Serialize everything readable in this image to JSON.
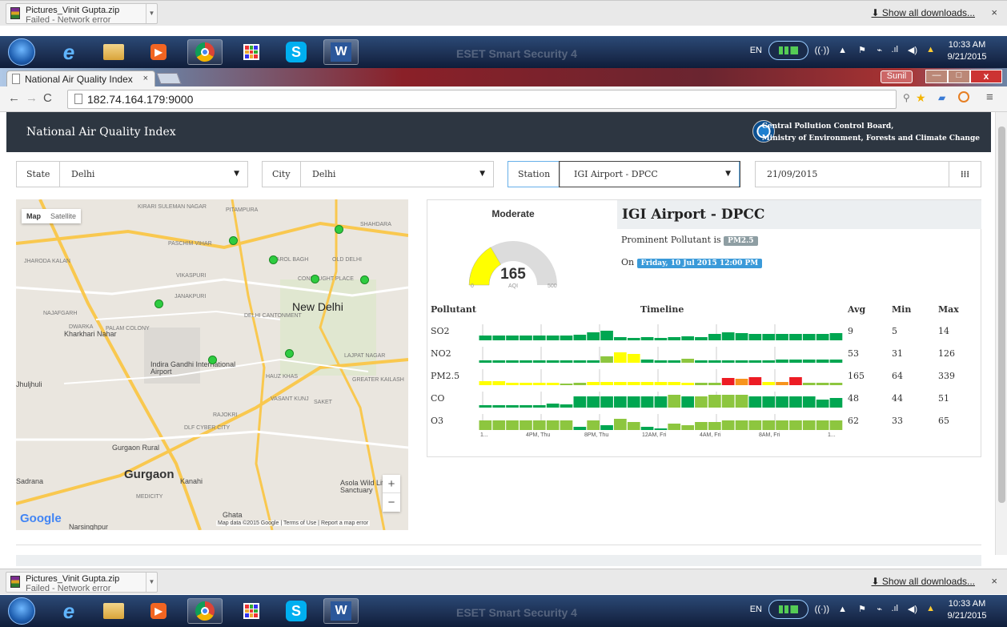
{
  "download_bar": {
    "file_name": "Pictures_Vinit Gupta.zip",
    "status": "Failed - Network error",
    "show_all": "Show all downloads...",
    "close": "×"
  },
  "taskbar": {
    "lang": "EN",
    "time": "10:33 AM",
    "date": "9/21/2015",
    "apps": [
      "ie-icon",
      "explorer-icon",
      "media-icon",
      "chrome-icon",
      "apps-icon",
      "skype-icon",
      "word-icon"
    ],
    "background_label": "ESET Smart Security 4"
  },
  "browser": {
    "tab_title": "National Air Quality Index",
    "tab_close": "×",
    "url": "182.74.164.179:9000",
    "user": "Sunil"
  },
  "site": {
    "title": "National Air Quality Index",
    "org_line1": "Central Pollution Control Board,",
    "org_line2": "Ministry of Environment, Forests and Climate Change"
  },
  "filters": {
    "state_label": "State",
    "state_value": "Delhi",
    "city_label": "City",
    "city_value": "Delhi",
    "station_label": "Station",
    "station_value": "IGI Airport - DPCC",
    "date_value": "21/09/2015"
  },
  "map": {
    "tab_map": "Map",
    "tab_satellite": "Satellite",
    "zoom_in": "+",
    "zoom_out": "−",
    "attribution": "Map data ©2015 Google",
    "terms": "Terms of Use",
    "report": "Report a map error",
    "google": "Google",
    "places": [
      {
        "name": "KIRARI SULEMAN NAGAR",
        "cls": "sm"
      },
      {
        "name": "PITAMPURA",
        "cls": "sm"
      },
      {
        "name": "SHAHDARA",
        "cls": "sm"
      },
      {
        "name": "PASCHIM VIHAR",
        "cls": "sm"
      },
      {
        "name": "KAROL BAGH",
        "cls": "sm"
      },
      {
        "name": "OLD DELHI",
        "cls": "sm"
      },
      {
        "name": "JHARODA KALAN",
        "cls": "sm"
      },
      {
        "name": "VIKASPURI",
        "cls": "sm"
      },
      {
        "name": "CONNAUGHT PLACE",
        "cls": "sm"
      },
      {
        "name": "JANAKPURI",
        "cls": "sm"
      },
      {
        "name": "New Delhi",
        "cls": "lg"
      },
      {
        "name": "NAJAFGARH",
        "cls": "sm"
      },
      {
        "name": "DELHI CANTONMENT",
        "cls": "sm"
      },
      {
        "name": "DWARKA",
        "cls": "sm"
      },
      {
        "name": "PALAM COLONY",
        "cls": "sm"
      },
      {
        "name": "Kharkhari Nahar",
        "cls": "md"
      },
      {
        "name": "Indira Gandhi International Airport",
        "cls": "md"
      },
      {
        "name": "LAJPAT NAGAR",
        "cls": "sm"
      },
      {
        "name": "HAUZ KHAS",
        "cls": "sm"
      },
      {
        "name": "GREATER KAILASH",
        "cls": "sm"
      },
      {
        "name": "Jhuljhuli",
        "cls": "md"
      },
      {
        "name": "VASANT KUNJ",
        "cls": "sm"
      },
      {
        "name": "SAKET",
        "cls": "sm"
      },
      {
        "name": "RAJOKRI",
        "cls": "sm"
      },
      {
        "name": "DLF CYBER CITY",
        "cls": "sm"
      },
      {
        "name": "Gurgaon Rural",
        "cls": "md"
      },
      {
        "name": "Gurgaon",
        "cls": "xl"
      },
      {
        "name": "Sadrana",
        "cls": "md"
      },
      {
        "name": "Kanahi",
        "cls": "md"
      },
      {
        "name": "MEDICITY",
        "cls": "sm"
      },
      {
        "name": "Asola Wild Life Sanctuary",
        "cls": "md"
      },
      {
        "name": "Ghata",
        "cls": "md"
      },
      {
        "name": "Narsinghpur",
        "cls": "md"
      }
    ]
  },
  "aqi": {
    "category": "Moderate",
    "value": 165,
    "unit": "AQI",
    "min": "0",
    "max": "500",
    "fraction": 0.33,
    "station": "IGI Airport - DPCC",
    "prominent_text": "Prominent Pollutant is",
    "prominent_value": "PM2.5",
    "on_text": "On",
    "datetime": "Friday, 10 Jul 2015 12:00 PM"
  },
  "table": {
    "headers": {
      "pollutant": "Pollutant",
      "timeline": "Timeline",
      "avg": "Avg",
      "min": "Min",
      "max": "Max"
    },
    "rows": [
      {
        "name": "SO2",
        "avg": "9",
        "min": "5",
        "max": "14"
      },
      {
        "name": "NO2",
        "avg": "53",
        "min": "31",
        "max": "126"
      },
      {
        "name": "PM2.5",
        "avg": "165",
        "min": "64",
        "max": "339"
      },
      {
        "name": "CO",
        "avg": "48",
        "min": "44",
        "max": "51"
      },
      {
        "name": "O3",
        "avg": "62",
        "min": "33",
        "max": "65"
      }
    ],
    "time_labels": [
      "1...",
      "4PM, Thu",
      "8PM, Thu",
      "12AM, Fri",
      "4AM, Fri",
      "8AM, Fri",
      "1..."
    ]
  },
  "colors": {
    "good": "#00a651",
    "satisfactory": "#8dc63f",
    "moderate": "#ffff00",
    "poor": "#f7941d",
    "very_poor": "#ed1c24",
    "header": "#2d3641",
    "badge_gray": "#8e9ea3",
    "badge_blue": "#3a9ad9"
  }
}
